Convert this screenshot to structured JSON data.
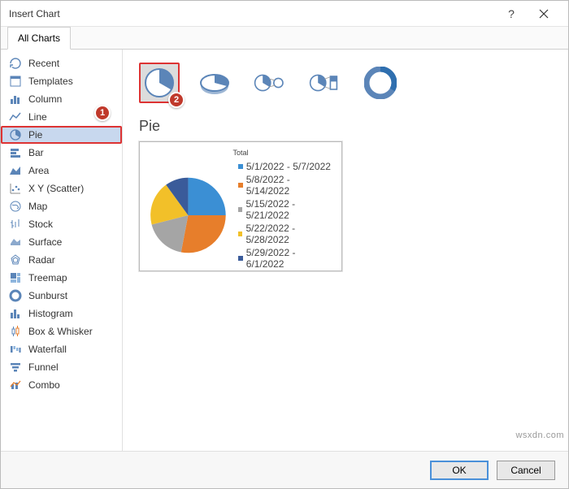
{
  "dialog": {
    "title": "Insert Chart"
  },
  "tab_label": "All Charts",
  "sidebar": {
    "items": [
      {
        "label": "Recent"
      },
      {
        "label": "Templates"
      },
      {
        "label": "Column"
      },
      {
        "label": "Line"
      },
      {
        "label": "Pie",
        "selected": true
      },
      {
        "label": "Bar"
      },
      {
        "label": "Area"
      },
      {
        "label": "X Y (Scatter)"
      },
      {
        "label": "Map"
      },
      {
        "label": "Stock"
      },
      {
        "label": "Surface"
      },
      {
        "label": "Radar"
      },
      {
        "label": "Treemap"
      },
      {
        "label": "Sunburst"
      },
      {
        "label": "Histogram"
      },
      {
        "label": "Box & Whisker"
      },
      {
        "label": "Waterfall"
      },
      {
        "label": "Funnel"
      },
      {
        "label": "Combo"
      }
    ]
  },
  "subtypes": [
    {
      "name": "pie",
      "selected": true
    },
    {
      "name": "pie-3d"
    },
    {
      "name": "pie-of-pie"
    },
    {
      "name": "bar-of-pie"
    },
    {
      "name": "doughnut"
    }
  ],
  "chart_name": "Pie",
  "preview": {
    "title": "Total",
    "legend": [
      {
        "label": "5/1/2022 - 5/7/2022",
        "color": "#3b8fd4"
      },
      {
        "label": "5/8/2022 - 5/14/2022",
        "color": "#e77e2b"
      },
      {
        "label": "5/15/2022 - 5/21/2022",
        "color": "#a5a5a5"
      },
      {
        "label": "5/22/2022 - 5/28/2022",
        "color": "#f2c029"
      },
      {
        "label": "5/29/2022 - 6/1/2022",
        "color": "#3a5b9a"
      }
    ]
  },
  "buttons": {
    "ok": "OK",
    "cancel": "Cancel"
  },
  "badges": {
    "one": "1",
    "two": "2"
  },
  "watermark": "wsxdn.com",
  "chart_data": {
    "type": "pie",
    "title": "Total",
    "series": [
      {
        "name": "5/1/2022 - 5/7/2022",
        "value": 25,
        "color": "#3b8fd4"
      },
      {
        "name": "5/8/2022 - 5/14/2022",
        "value": 28,
        "color": "#e77e2b"
      },
      {
        "name": "5/15/2022 - 5/21/2022",
        "value": 18,
        "color": "#a5a5a5"
      },
      {
        "name": "5/22/2022 - 5/28/2022",
        "value": 19,
        "color": "#f2c029"
      },
      {
        "name": "5/29/2022 - 6/1/2022",
        "value": 10,
        "color": "#3a5b9a"
      }
    ]
  }
}
